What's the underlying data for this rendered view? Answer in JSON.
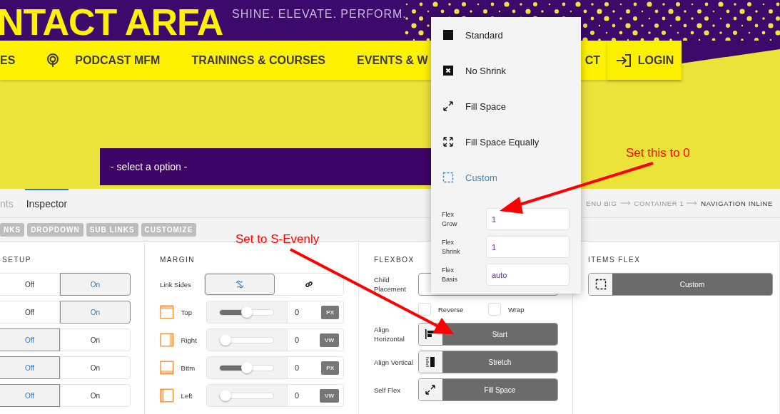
{
  "site": {
    "title": "NTACT ARFA",
    "tagline": "SHINE. ELEVATE. PERFORM.",
    "nav": [
      {
        "label": "ES",
        "kind": "text"
      },
      {
        "label": "PODCAST MFM",
        "kind": "podcast"
      },
      {
        "label": "TRAININGS & COURSES",
        "kind": "text"
      },
      {
        "label": "EVENTS & W",
        "kind": "text"
      },
      {
        "label": "CT",
        "kind": "text"
      }
    ],
    "login": "LOGIN",
    "select": "- select a option -"
  },
  "inspector": {
    "tabs": [
      {
        "label": "nts",
        "selected": false
      },
      {
        "label": "Inspector",
        "selected": true
      }
    ],
    "breadcrumb": [
      "ENU BIG",
      "CONTAINER 1",
      "NAVIGATION INLINE"
    ],
    "tags": [
      "NKS",
      "DROPDOWN",
      "SUB LINKS",
      "CUSTOMIZE"
    ],
    "setup": {
      "title": "SETUP",
      "rows": [
        {
          "options": [
            {
              "label": "Off",
              "selected": false
            },
            {
              "label": "On",
              "selected": true
            }
          ]
        },
        {
          "options": [
            {
              "label": "Off",
              "selected": false
            },
            {
              "label": "On",
              "selected": true
            }
          ]
        },
        {
          "options": [
            {
              "label": "Off",
              "selected": true
            },
            {
              "label": "On",
              "selected": false
            }
          ]
        },
        {
          "options": [
            {
              "label": "Off",
              "selected": true
            },
            {
              "label": "On",
              "selected": false
            }
          ]
        },
        {
          "options": [
            {
              "label": "Off",
              "selected": true
            },
            {
              "label": "On",
              "selected": false
            }
          ]
        }
      ]
    },
    "margin": {
      "title": "MARGIN",
      "link_label": "Link Sides",
      "link_options": [
        {
          "kind": "unlink",
          "selected": true
        },
        {
          "kind": "link",
          "selected": false
        }
      ],
      "sides": [
        {
          "label": "Top",
          "kind": "top",
          "level": 0.5,
          "value": "0",
          "unit": "PX"
        },
        {
          "label": "Right",
          "kind": "right",
          "level": 0,
          "value": "0",
          "unit": "VW"
        },
        {
          "label": "Bttm",
          "kind": "bottom",
          "level": 0.5,
          "value": "0",
          "unit": "PX"
        },
        {
          "label": "Left",
          "kind": "left",
          "level": 0,
          "value": "0",
          "unit": "VW"
        }
      ]
    },
    "flexbox": {
      "title": "FLEXBOX",
      "placement_label": "Child Placement",
      "checks": [
        {
          "label": "Reverse",
          "checked": false
        },
        {
          "label": "Wrap",
          "checked": false
        }
      ],
      "rows": [
        {
          "label": "Align Horizontal",
          "kind": "align-start",
          "value": "Start"
        },
        {
          "label": "Align Vertical",
          "kind": "stretch",
          "value": "Stretch"
        },
        {
          "label": "Self Flex",
          "kind": "fill-space",
          "value": "Fill Space"
        }
      ]
    },
    "items_flex": {
      "title": "ITEMS FLEX",
      "kind": "custom",
      "value": "Custom"
    },
    "menu": {
      "options": [
        {
          "label": "Standard",
          "kind": "standard",
          "selected": false
        },
        {
          "label": "No Shrink",
          "kind": "no-shrink",
          "selected": false
        },
        {
          "label": "Fill Space",
          "kind": "fill-space",
          "selected": false
        },
        {
          "label": "Fill Space Equally",
          "kind": "fill-equal",
          "selected": false
        },
        {
          "label": "Custom",
          "kind": "custom",
          "selected": true
        }
      ],
      "fields": [
        {
          "label": "Flex Grow",
          "value": "1"
        },
        {
          "label": "Flex Shrink",
          "value": "1"
        },
        {
          "label": "Flex Basis",
          "value": "auto"
        }
      ]
    }
  },
  "annotations": [
    {
      "text": "Set this to 0"
    },
    {
      "text": "Set to S-Evenly"
    }
  ]
}
